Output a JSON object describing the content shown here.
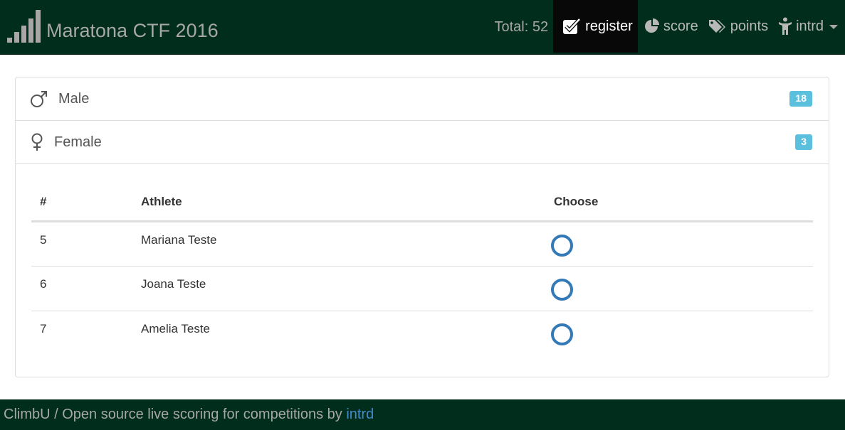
{
  "navbar": {
    "brand_title": "Maratona CTF 2016",
    "total_text": "Total: 52",
    "items": [
      {
        "label": "register",
        "icon": "checkbox-icon",
        "active": true
      },
      {
        "label": "score",
        "icon": "pie-chart-icon",
        "active": false
      },
      {
        "label": "points",
        "icon": "tags-icon",
        "active": false
      },
      {
        "label": "intrd",
        "icon": "person-icon",
        "active": false,
        "dropdown": true
      }
    ]
  },
  "groups": [
    {
      "label": "Male",
      "icon": "male-icon",
      "count": "18"
    },
    {
      "label": "Female",
      "icon": "female-icon",
      "count": "3"
    }
  ],
  "table": {
    "headers": [
      "#",
      "Athlete",
      "Choose"
    ],
    "rows": [
      {
        "num": "5",
        "athlete": "Mariana Teste"
      },
      {
        "num": "6",
        "athlete": "Joana Teste"
      },
      {
        "num": "7",
        "athlete": "Amelia Teste"
      }
    ]
  },
  "footer": {
    "text": "ClimbU / Open source live scoring for competitions by ",
    "link": "intrd"
  },
  "colors": {
    "navbar_bg": "#012e1c",
    "active_bg": "#080808",
    "badge": "#5bc0de",
    "radio": "#337ab7",
    "link": "#428bca"
  }
}
